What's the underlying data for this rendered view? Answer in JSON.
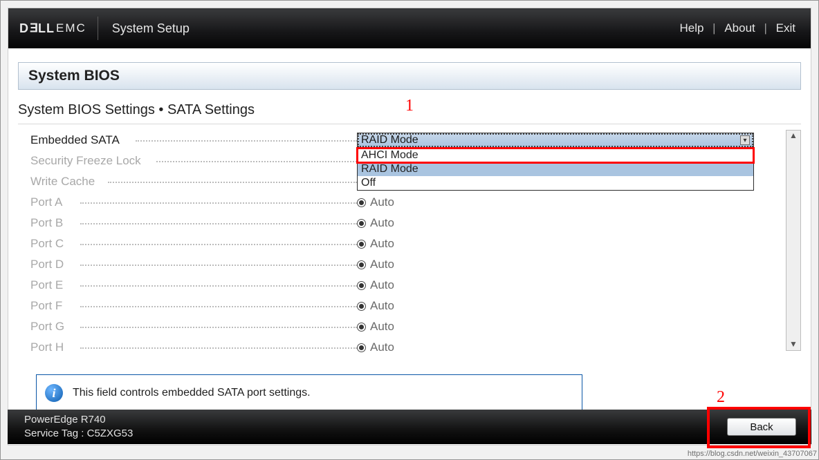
{
  "header": {
    "brand_prefix": "D",
    "brand_e": "E",
    "brand_ll": "LL",
    "brand_emc": "EMC",
    "app_title": "System Setup",
    "links": {
      "help": "Help",
      "about": "About",
      "exit": "Exit"
    }
  },
  "title_band": "System BIOS",
  "subtitle": "System BIOS Settings • SATA Settings",
  "annotations": {
    "one": "1",
    "two": "2"
  },
  "settings": {
    "embedded_sata": {
      "label": "Embedded SATA",
      "selected": "RAID Mode",
      "options": [
        "AHCI Mode",
        "RAID Mode",
        "Off"
      ]
    },
    "security_freeze_lock": {
      "label": "Security Freeze Lock"
    },
    "write_cache": {
      "label": "Write Cache"
    },
    "ports": [
      {
        "label": "Port A",
        "value": "Auto"
      },
      {
        "label": "Port B",
        "value": "Auto"
      },
      {
        "label": "Port C",
        "value": "Auto"
      },
      {
        "label": "Port D",
        "value": "Auto"
      },
      {
        "label": "Port E",
        "value": "Auto"
      },
      {
        "label": "Port F",
        "value": "Auto"
      },
      {
        "label": "Port G",
        "value": "Auto"
      },
      {
        "label": "Port H",
        "value": "Auto"
      }
    ]
  },
  "info_text": "This field controls embedded SATA port settings.",
  "footer": {
    "model": "PowerEdge R740",
    "service_tag_label": "Service Tag :",
    "service_tag": "C5ZXG53",
    "back": "Back"
  },
  "watermark": "https://blog.csdn.net/weixin_43707067"
}
